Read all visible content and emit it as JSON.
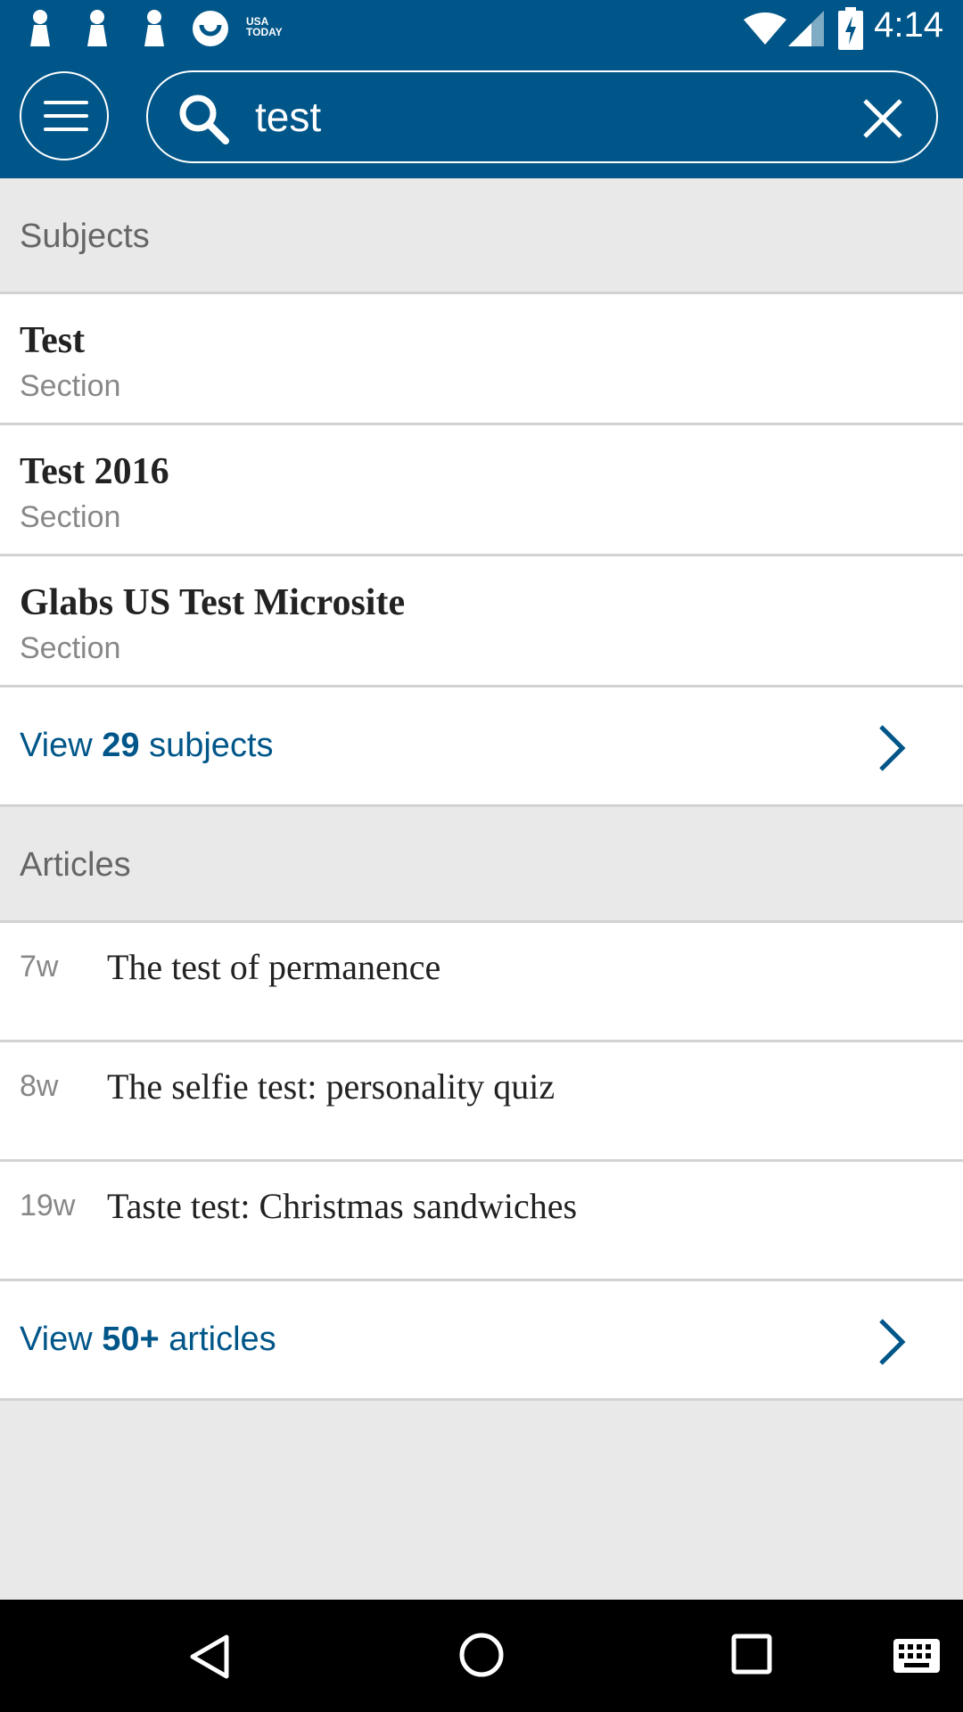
{
  "status_bar": {
    "time": "4:14",
    "left_icons": [
      "notification-icon",
      "notification-icon",
      "notification-icon",
      "usa-today-icon"
    ],
    "usa_today_label": "USA TODAY",
    "right_icons": [
      "wifi-icon",
      "signal-icon",
      "battery-charging-icon"
    ]
  },
  "app_bar": {
    "menu_icon": "hamburger-menu-icon",
    "search_value": "test",
    "search_icon": "search-icon",
    "clear_icon": "close-icon"
  },
  "subjects": {
    "header": "Subjects",
    "items": [
      {
        "title": "Test",
        "type": "Section"
      },
      {
        "title": "Test 2016",
        "type": "Section"
      },
      {
        "title": "Glabs US Test Microsite",
        "type": "Section"
      }
    ],
    "view_more": {
      "prefix": "View",
      "count": "29",
      "suffix": "subjects"
    }
  },
  "articles": {
    "header": "Articles",
    "items": [
      {
        "age": "7w",
        "title": "The test of permanence"
      },
      {
        "age": "8w",
        "title": "The selfie test: personality quiz"
      },
      {
        "age": "19w",
        "title": "Taste test: Christmas sandwiches"
      }
    ],
    "view_more": {
      "prefix": "View",
      "count": "50+",
      "suffix": "articles"
    }
  },
  "nav_bar": {
    "icons": [
      "back-icon",
      "home-icon",
      "recents-icon",
      "keyboard-icon"
    ]
  },
  "colors": {
    "brand": "#005689",
    "background": "#e9e9e9",
    "divider": "#d2d2d2"
  }
}
